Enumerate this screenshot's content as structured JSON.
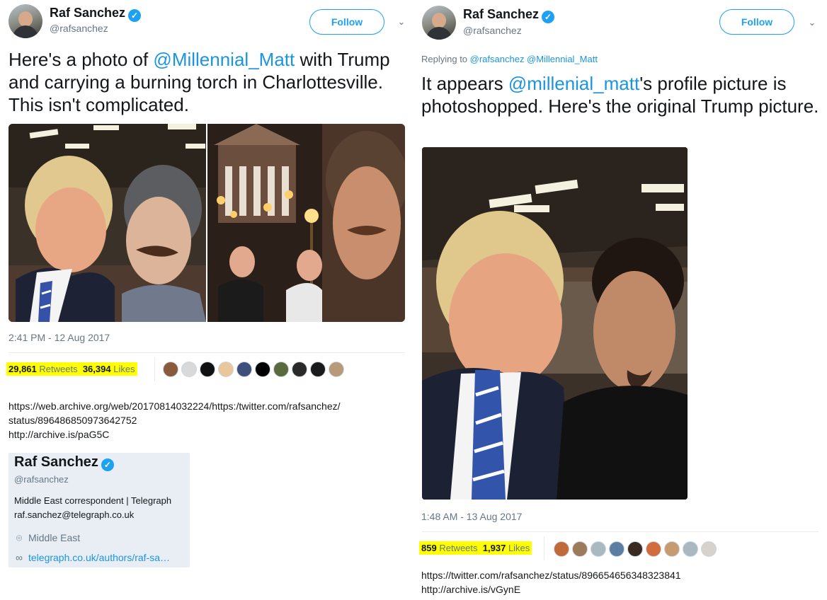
{
  "left": {
    "author": {
      "name": "Raf Sanchez",
      "handle": "@rafsanchez"
    },
    "follow_label": "Follow",
    "tweet": {
      "before": "Here's a photo of ",
      "mention": "@Millennial_Matt",
      "after": " with Trump and carrying a burning torch in Charlottesville. This isn't complicated."
    },
    "timestamp": "2:41 PM - 12 Aug 2017",
    "retweets_count": "29,861",
    "retweets_label": "Retweets",
    "likes_count": "36,394",
    "likes_label": "Likes",
    "urls": [
      "https://web.archive.org/web/20170814032224/https:/twitter.com/rafsanchez/",
      "status/896486850973642752",
      "http://archive.is/paG5C"
    ],
    "profile_card": {
      "name": "Raf Sanchez",
      "handle": "@rafsanchez",
      "bio_line1": "Middle East correspondent | Telegraph",
      "bio_line2": "raf.sanchez@telegraph.co.uk",
      "location": "Middle East",
      "link": "telegraph.co.uk/authors/raf-sa…"
    }
  },
  "right": {
    "author": {
      "name": "Raf Sanchez",
      "handle": "@rafsanchez"
    },
    "follow_label": "Follow",
    "reply_prefix": "Replying to ",
    "reply_handles": "@rafsanchez @Millennial_Matt",
    "tweet": {
      "before": "It appears ",
      "mention": "@millenial_matt",
      "after": "'s profile picture is photoshopped. Here's the original Trump picture."
    },
    "timestamp": "1:48 AM - 13 Aug 2017",
    "retweets_count": "859",
    "retweets_label": "Retweets",
    "likes_count": "1,937",
    "likes_label": "Likes",
    "urls": [
      "https://twitter.com/rafsanchez/status/896654656348323841",
      "http://archive.is/vGynE"
    ]
  },
  "icons": {
    "verified": "verified-badge-icon",
    "chevron": "chevron-down-icon",
    "location": "location-pin-icon",
    "link": "link-icon"
  },
  "colors": {
    "accent": "#1da1f2",
    "mention": "#1b95e0",
    "highlight": "#ffff00",
    "muted": "#657786"
  }
}
